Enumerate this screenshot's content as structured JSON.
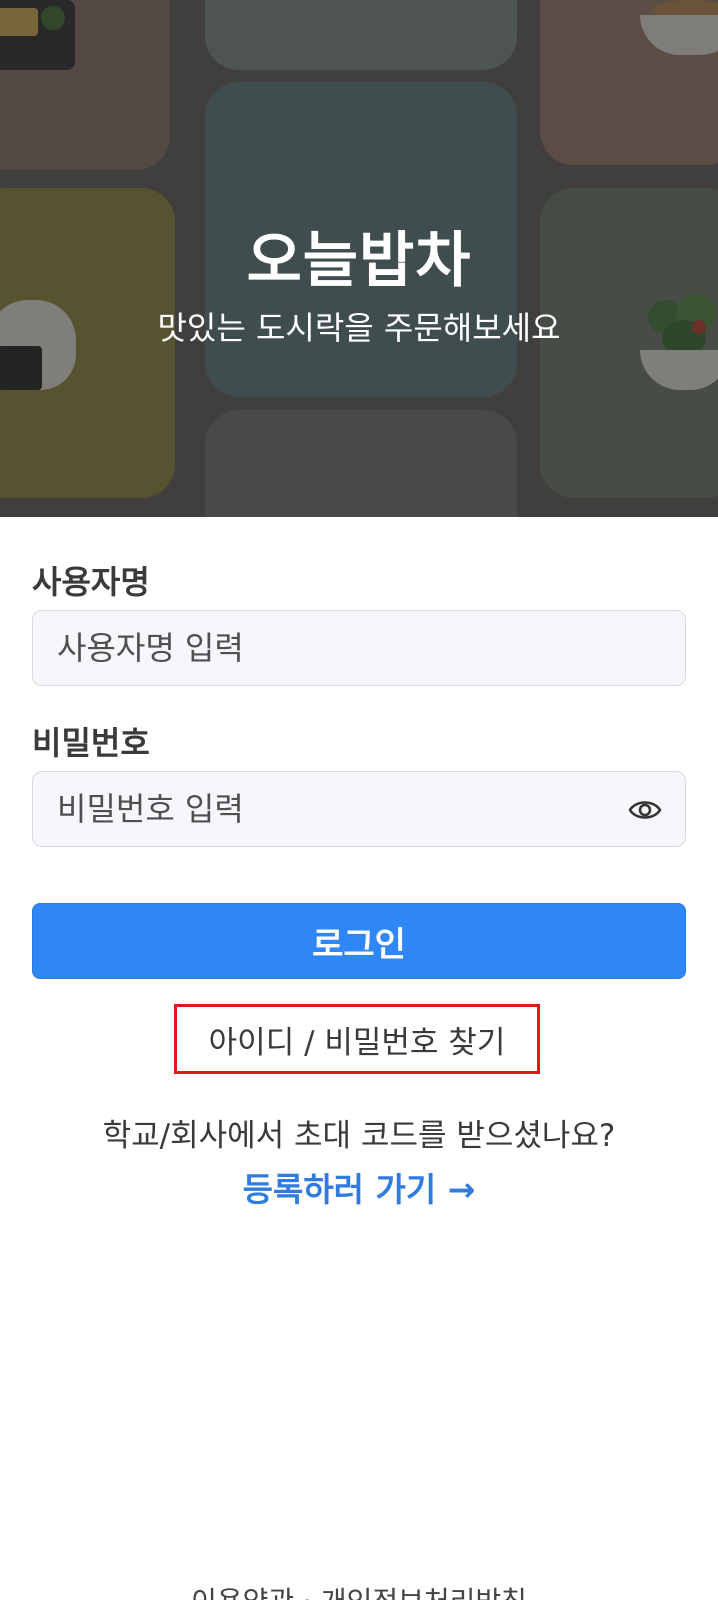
{
  "hero": {
    "brand_title": "오늘밥차",
    "tagline": "맛있는 도시락을 주문해보세요"
  },
  "form": {
    "username_label": "사용자명",
    "username_placeholder": "사용자명 입력",
    "password_label": "비밀번호",
    "password_placeholder": "비밀번호 입력",
    "password_toggle_icon": "eye-icon",
    "login_button": "로그인"
  },
  "links": {
    "find_account": "아이디 / 비밀번호 찾기",
    "invite_question": "학교/회사에서 초대 코드를 받으셨나요?",
    "register": "등록하러 가기 →"
  },
  "footer": {
    "text": "이용약관 · 개인정보처리방침"
  },
  "colors": {
    "primary": "#2f86f6",
    "link": "#2f7be0",
    "highlight_border": "#e01818",
    "field_bg": "#f5f7fa"
  }
}
